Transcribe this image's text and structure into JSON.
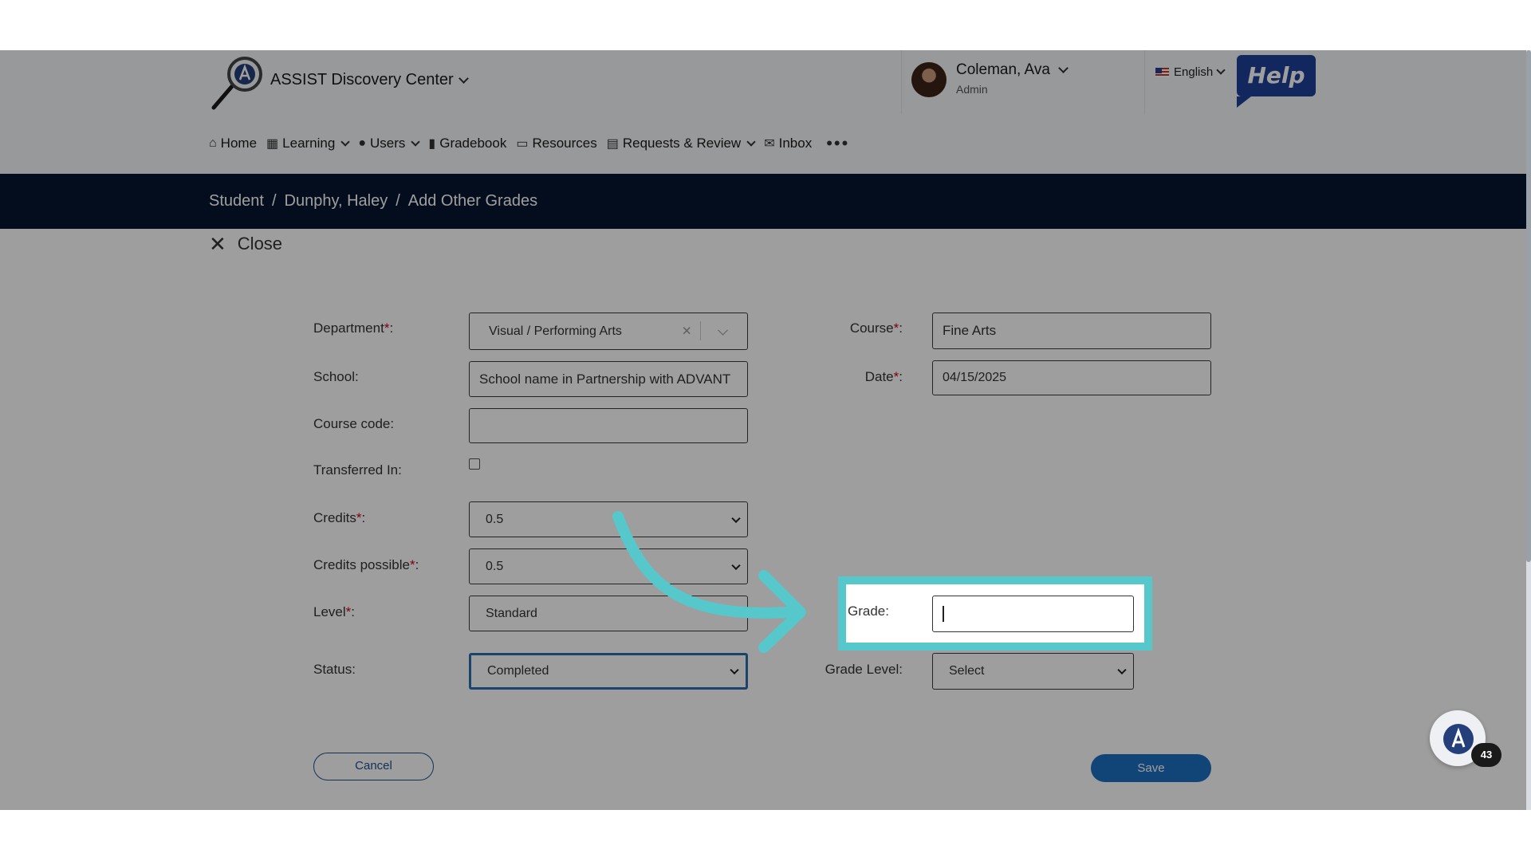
{
  "header": {
    "org": "ASSIST Discovery Center",
    "user_name": "Coleman, Ava",
    "user_role": "Admin",
    "language": "English",
    "help_label": "Help"
  },
  "nav": {
    "items": [
      "Home",
      "Learning",
      "Users",
      "Gradebook",
      "Resources",
      "Requests & Review",
      "Inbox"
    ]
  },
  "breadcrumb": [
    "Student",
    "Dunphy, Haley",
    "Add Other Grades"
  ],
  "close_label": "Close",
  "form": {
    "department": {
      "label": "Department",
      "value": "Visual / Performing Arts"
    },
    "school": {
      "label": "School",
      "value": "School name in Partnership with ADVANT"
    },
    "course_code": {
      "label": "Course code",
      "value": ""
    },
    "transferred_in": {
      "label": "Transferred In",
      "checked": false
    },
    "credits": {
      "label": "Credits",
      "value": "0.5"
    },
    "credits_possible": {
      "label": "Credits possible",
      "value": "0.5"
    },
    "level": {
      "label": "Level",
      "value": "Standard"
    },
    "status": {
      "label": "Status",
      "value": "Completed"
    },
    "course": {
      "label": "Course",
      "value": "Fine Arts"
    },
    "date": {
      "label": "Date",
      "value": "04/15/2025"
    },
    "grade": {
      "label": "Grade",
      "value": ""
    },
    "grade_level": {
      "label": "Grade Level",
      "value": "Select"
    }
  },
  "buttons": {
    "cancel": "Cancel",
    "save": "Save"
  },
  "chat_badge": "43",
  "colors": {
    "highlight": "#56c8cc",
    "breadcrumb_bg": "#06162f",
    "save_bg": "#1c6fc0",
    "help_bg": "#1f3f9a"
  }
}
